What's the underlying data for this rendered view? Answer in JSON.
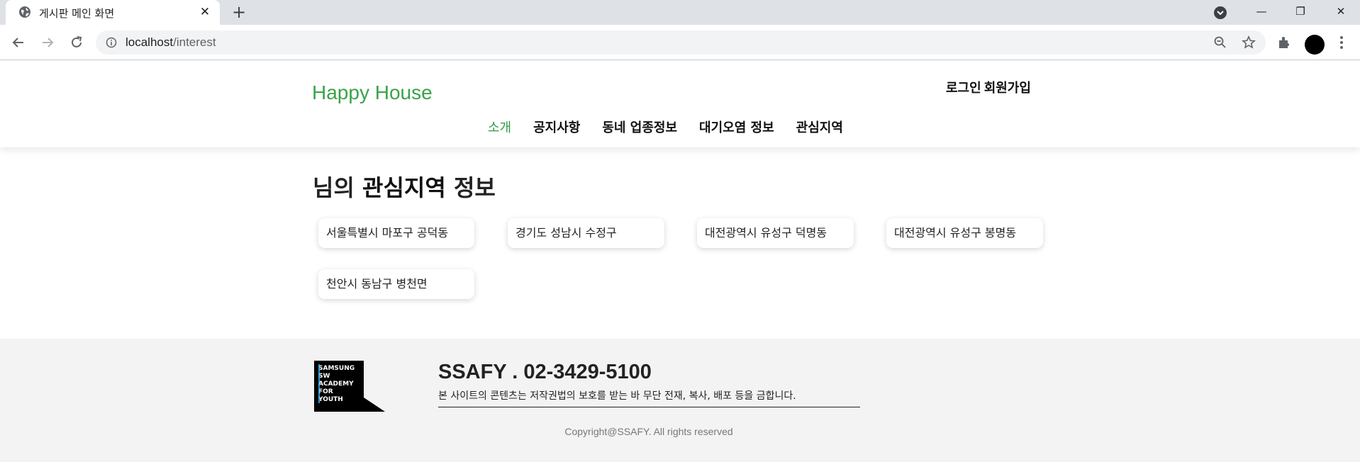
{
  "browser": {
    "tab_title": "게시판 메인 화면",
    "tab_close": "✕",
    "new_tab": "+",
    "url_host": "localhost",
    "url_path": "/interest",
    "window_controls": {
      "minimize": "—",
      "maximize": "❐",
      "close": "✕"
    }
  },
  "header": {
    "logo": "Happy House",
    "auth": {
      "login": "로그인",
      "signup": "회원가입"
    },
    "nav": [
      "소개",
      "공지사항",
      "동네 업종정보",
      "대기오염 정보",
      "관심지역"
    ],
    "active_nav": "소개"
  },
  "main": {
    "title_prefix": "님의",
    "title_bold": "관심지역",
    "title_suffix": "정보",
    "regions": [
      "서울특별시 마포구 공덕동",
      "경기도 성남시 수정구",
      "대전광역시 유성구 덕명동",
      "대전광역시 유성구 봉명동",
      "천안시 동남구 병천면"
    ]
  },
  "footer": {
    "logo_lines": [
      "SAMSUNG",
      "SW",
      "ACADEMY",
      "FOR",
      "YOUTH"
    ],
    "phone": "SSAFY . 02-3429-5100",
    "notice": "본 사이트의 콘텐츠는 저작권법의 보호를 받는 바 무단 전재, 복사, 배포 등을 금합니다.",
    "copyright": "Copyright@SSAFY. All rights reserved"
  },
  "colors": {
    "brand_green": "#3aa34a",
    "active_nav": "#2e9a45",
    "footer_bg": "#f3f3f3"
  }
}
